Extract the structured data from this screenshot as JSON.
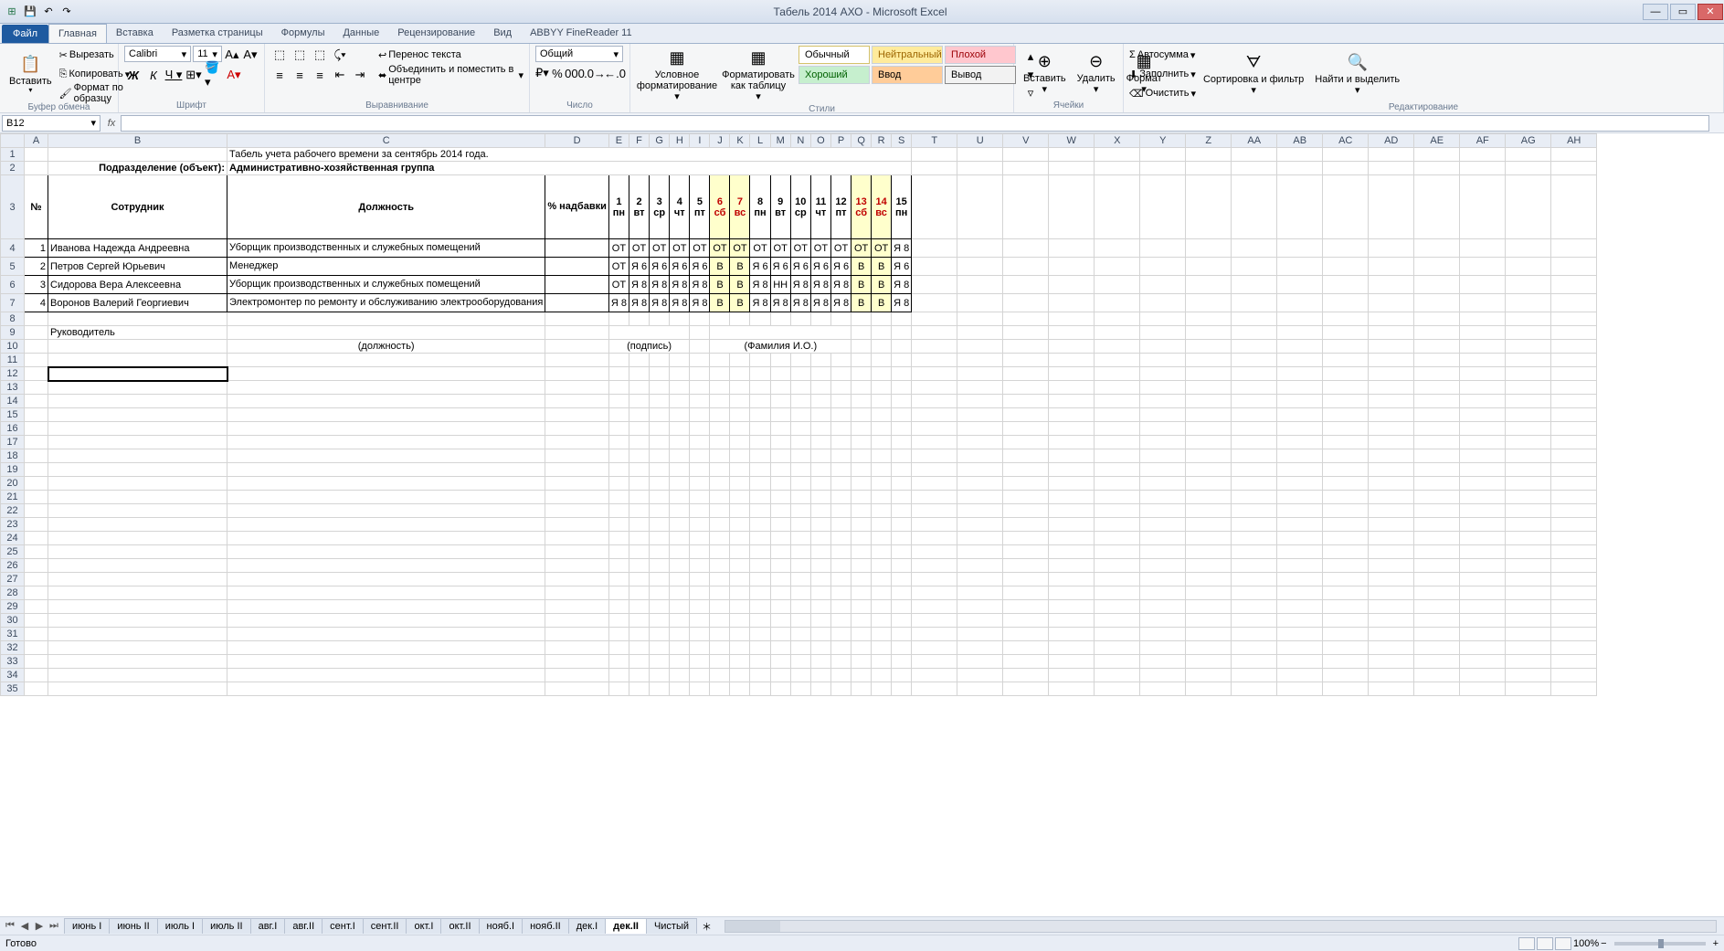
{
  "app": {
    "title": "Табель 2014 АХО - Microsoft Excel"
  },
  "qat": {
    "save": "💾",
    "undo": "↶",
    "redo": "↷"
  },
  "tabs": {
    "file": "Файл",
    "items": [
      "Главная",
      "Вставка",
      "Разметка страницы",
      "Формулы",
      "Данные",
      "Рецензирование",
      "Вид",
      "ABBYY FineReader 11"
    ],
    "active": 0
  },
  "ribbon": {
    "clipboard": {
      "paste": "Вставить",
      "cut": "Вырезать",
      "copy": "Копировать",
      "format": "Формат по образцу",
      "label": "Буфер обмена"
    },
    "font": {
      "name": "Calibri",
      "size": "11",
      "label": "Шрифт"
    },
    "align": {
      "wrap": "Перенос текста",
      "merge": "Объединить и поместить в центре",
      "label": "Выравнивание"
    },
    "number": {
      "fmt": "Общий",
      "label": "Число"
    },
    "styles": {
      "cond": "Условное форматирование",
      "table": "Форматировать как таблицу",
      "label": "Стили",
      "normal": "Обычный",
      "neutral": "Нейтральный",
      "bad": "Плохой",
      "good": "Хороший",
      "input": "Ввод",
      "output": "Вывод"
    },
    "cells": {
      "insert": "Вставить",
      "delete": "Удалить",
      "format": "Формат",
      "label": "Ячейки"
    },
    "editing": {
      "sum": "Автосумма",
      "fill": "Заполнить",
      "clear": "Очистить",
      "sort": "Сортировка и фильтр",
      "find": "Найти и выделить",
      "label": "Редактирование"
    }
  },
  "namebox": "B12",
  "columns": [
    "A",
    "B",
    "C",
    "D",
    "E",
    "F",
    "G",
    "H",
    "I",
    "J",
    "K",
    "L",
    "M",
    "N",
    "O",
    "P",
    "Q",
    "R",
    "S",
    "T",
    "U",
    "V",
    "W",
    "X",
    "Y",
    "Z",
    "AA",
    "AB",
    "AC",
    "AD",
    "AE",
    "AF",
    "AG",
    "AH"
  ],
  "sheet": {
    "title": "Табель учета рабочего времени за сентябрь 2014  года.",
    "dept_label": "Подразделение (объект):",
    "dept_value": "Административно-хозяйственная группа",
    "hdr": {
      "num": "№",
      "emp": "Сотрудник",
      "pos": "Должность",
      "pct": "% надбавки"
    },
    "days": [
      {
        "n": "1",
        "d": "пн",
        "w": false
      },
      {
        "n": "2",
        "d": "вт",
        "w": false
      },
      {
        "n": "3",
        "d": "ср",
        "w": false
      },
      {
        "n": "4",
        "d": "чт",
        "w": false
      },
      {
        "n": "5",
        "d": "пт",
        "w": false
      },
      {
        "n": "6",
        "d": "сб",
        "w": true
      },
      {
        "n": "7",
        "d": "вс",
        "w": true
      },
      {
        "n": "8",
        "d": "пн",
        "w": false
      },
      {
        "n": "9",
        "d": "вт",
        "w": false
      },
      {
        "n": "10",
        "d": "ср",
        "w": false
      },
      {
        "n": "11",
        "d": "чт",
        "w": false
      },
      {
        "n": "12",
        "d": "пт",
        "w": false
      },
      {
        "n": "13",
        "d": "сб",
        "w": true
      },
      {
        "n": "14",
        "d": "вс",
        "w": true
      },
      {
        "n": "15",
        "d": "пн",
        "w": false
      }
    ],
    "rows": [
      {
        "n": "1",
        "name": "Иванова Надежда Андреевна",
        "pos": "Уборщик производственных и служебных помещений",
        "pct": "",
        "c": [
          "ОТ",
          "ОТ",
          "ОТ",
          "ОТ",
          "ОТ",
          "ОТ",
          "ОТ",
          "ОТ",
          "ОТ",
          "ОТ",
          "ОТ",
          "ОТ",
          "ОТ",
          "ОТ",
          "Я 8"
        ]
      },
      {
        "n": "2",
        "name": "Петров Сергей Юрьевич",
        "pos": "Менеджер",
        "pct": "",
        "c": [
          "ОТ",
          "Я 6",
          "Я 6",
          "Я 6",
          "Я 6",
          "В",
          "В",
          "Я 6",
          "Я 6",
          "Я 6",
          "Я 6",
          "Я 6",
          "В",
          "В",
          "Я 6"
        ]
      },
      {
        "n": "3",
        "name": "Сидорова Вера Алексеевна",
        "pos": "Уборщик производственных и служебных помещений",
        "pct": "",
        "c": [
          "ОТ",
          "Я 8",
          "Я 8",
          "Я 8",
          "Я 8",
          "В",
          "В",
          "Я 8",
          "НН",
          "Я 8",
          "Я 8",
          "Я 8",
          "В",
          "В",
          "Я 8"
        ]
      },
      {
        "n": "4",
        "name": "Воронов Валерий Георгиевич",
        "pos": "Электромонтер по ремонту и обслуживанию электрооборудования",
        "pct": "",
        "c": [
          "Я 8",
          "Я 8",
          "Я 8",
          "Я 8",
          "Я 8",
          "В",
          "В",
          "Я 8",
          "Я 8",
          "Я 8",
          "Я 8",
          "Я 8",
          "В",
          "В",
          "Я 8"
        ]
      }
    ],
    "footer": {
      "head": "Руководитель",
      "pos": "(должность)",
      "sign": "(подпись)",
      "fio": "(Фамилия И.О.)"
    }
  },
  "sheetTabs": [
    "июнь I",
    "июнь II",
    "июль I",
    "июль II",
    "авг.I",
    "авг.II",
    "сент.I",
    "сент.II",
    "окт.I",
    "окт.II",
    "нояб.I",
    "нояб.II",
    "дек.I",
    "дек.II",
    "Чистый"
  ],
  "activeSheetTab": 13,
  "status": {
    "ready": "Готово",
    "zoom": "100%"
  }
}
